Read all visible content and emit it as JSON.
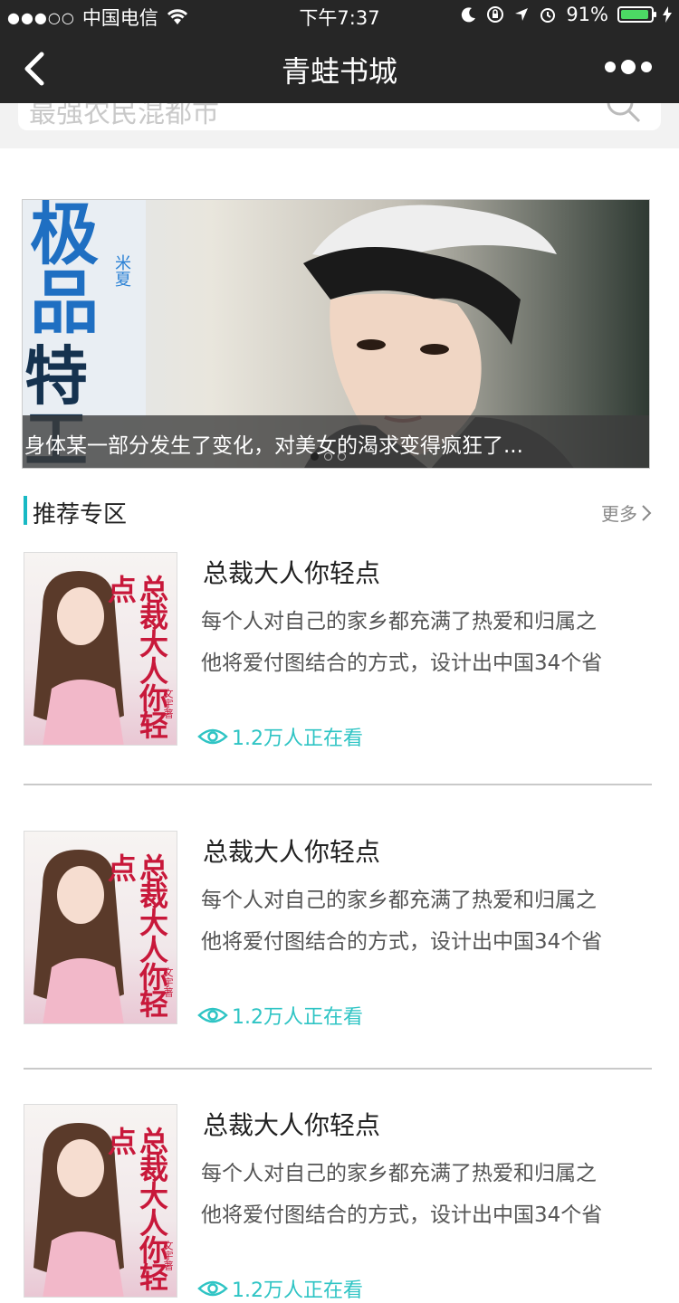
{
  "status_bar": {
    "signal_dots": "●●●○○",
    "carrier": "中国电信",
    "time": "下午7:37",
    "battery_percent": "91%",
    "battery_level": 0.91
  },
  "nav": {
    "title": "青蛙书城"
  },
  "search": {
    "placeholder": "最强农民混都市"
  },
  "banner": {
    "cover_title_1": "极品",
    "cover_title_2": "特工",
    "cover_author": "米夏",
    "caption": "身体某一部分发生了变化，对美女的渴求变得疯狂了...",
    "pages": 3,
    "active_page": 1
  },
  "section": {
    "title": "推荐专区",
    "more_label": "更多"
  },
  "books": [
    {
      "title": "总裁大人你轻点",
      "cover_title": "总裁大人你轻点",
      "cover_author": "文宇著",
      "desc_line1": "每个人对自己的家乡都充满了热爱和归属之",
      "desc_line2": "他将爱付图结合的方式，设计出中国34个省",
      "readers": "1.2万人正在看"
    },
    {
      "title": "总裁大人你轻点",
      "cover_title": "总裁大人你轻点",
      "cover_author": "文宇著",
      "desc_line1": "每个人对自己的家乡都充满了热爱和归属之",
      "desc_line2": "他将爱付图结合的方式，设计出中国34个省",
      "readers": "1.2万人正在看"
    },
    {
      "title": "总裁大人你轻点",
      "cover_title": "总裁大人你轻点",
      "cover_author": "文宇著",
      "desc_line1": "每个人对自己的家乡都充满了热爱和归属之",
      "desc_line2": "他将爱付图结合的方式，设计出中国34个省",
      "readers": "1.2万人正在看"
    }
  ],
  "colors": {
    "accent": "#18b9c4",
    "header_bg": "#262626"
  }
}
